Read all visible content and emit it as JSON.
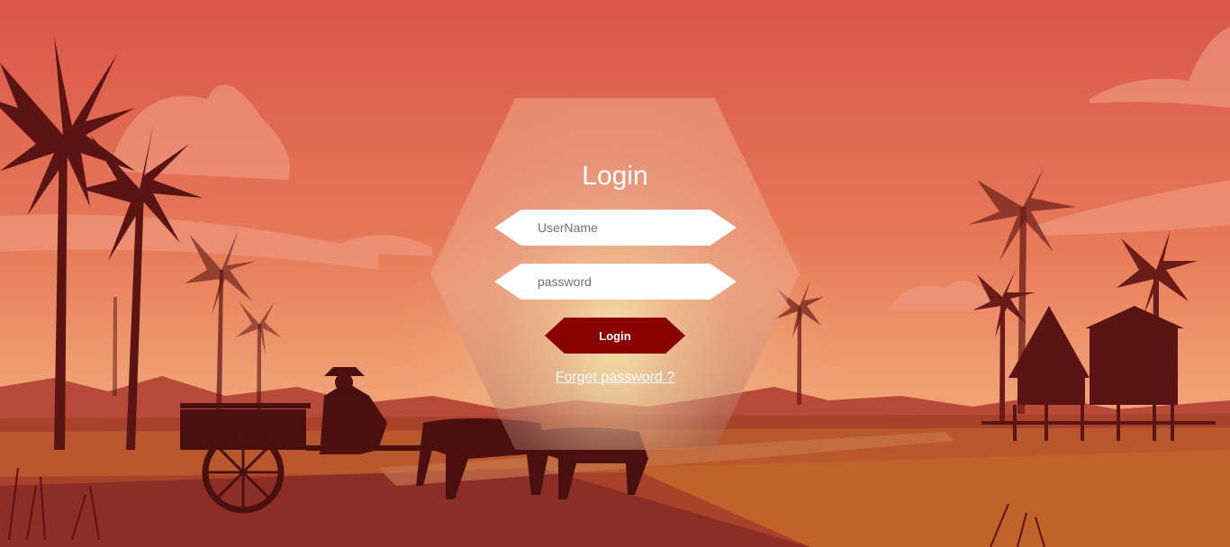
{
  "login": {
    "title": "Login",
    "username_placeholder": "UserName",
    "password_placeholder": "password",
    "submit_label": "Login",
    "forgot_label": "Forget password ?"
  },
  "colors": {
    "sky_top": "#d9564a",
    "sky_mid": "#ea8a62",
    "horizon_glow": "#f6d6a4",
    "silhouette": "#5a1414",
    "ground": "#a8422a",
    "button": "#8b0000"
  }
}
